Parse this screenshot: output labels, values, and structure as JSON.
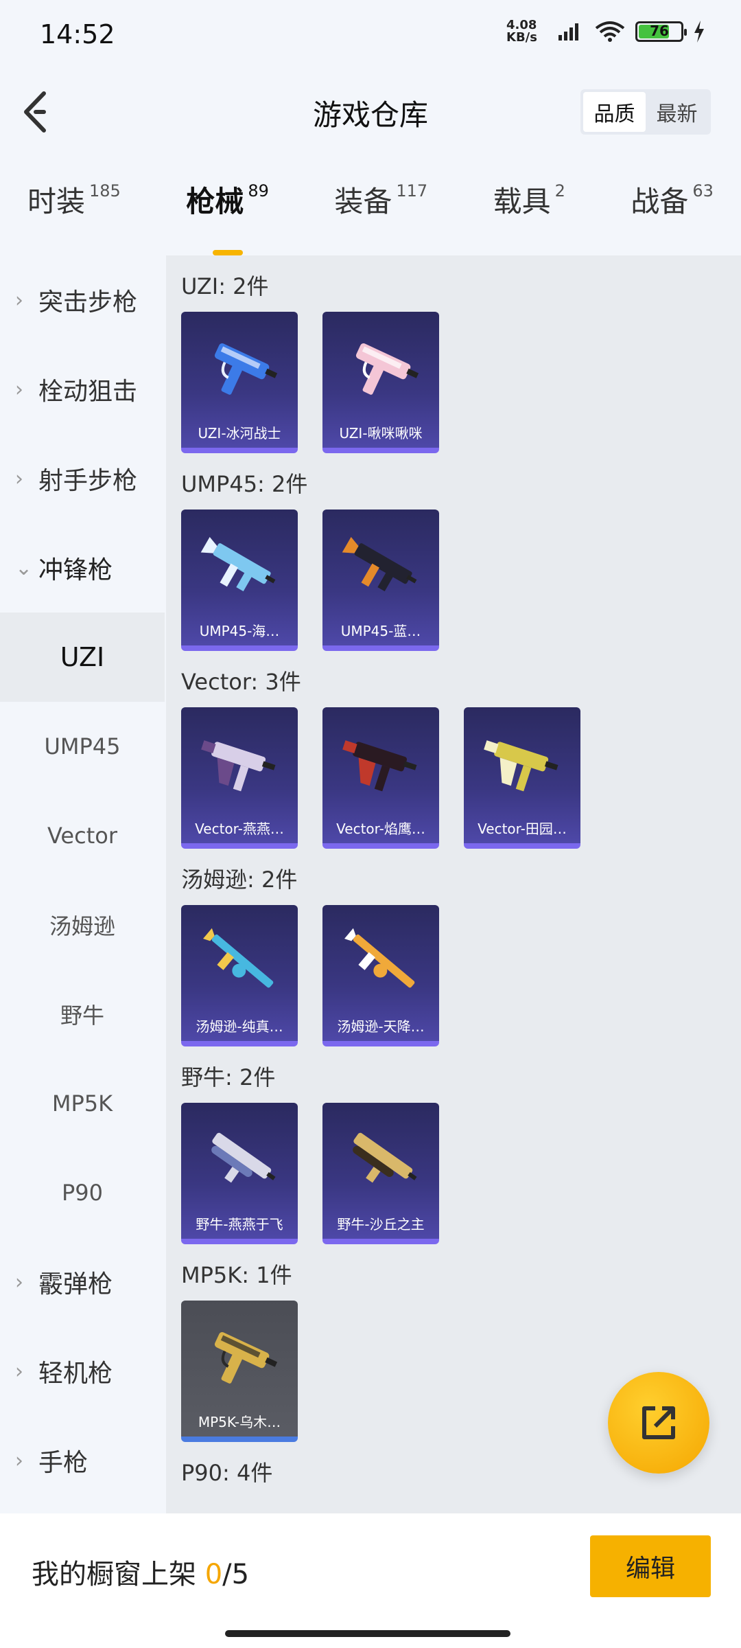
{
  "status": {
    "time": "14:52",
    "net_speed_top": "4.08",
    "net_speed_bottom": "KB/s",
    "battery": "76",
    "battery_level": 0.76
  },
  "header": {
    "title": "游戏仓库",
    "sort": [
      "品质",
      "最新"
    ],
    "active_sort": 0
  },
  "tabs": [
    {
      "label": "时装",
      "count": "185"
    },
    {
      "label": "枪械",
      "count": "89"
    },
    {
      "label": "装备",
      "count": "117"
    },
    {
      "label": "载具",
      "count": "2"
    },
    {
      "label": "战备",
      "count": "63"
    }
  ],
  "active_tab": 1,
  "sidebar": {
    "items": [
      {
        "label": "突击步枪",
        "type": "category"
      },
      {
        "label": "栓动狙击",
        "type": "category"
      },
      {
        "label": "射手步枪",
        "type": "category"
      },
      {
        "label": "冲锋枪",
        "type": "category",
        "open": true
      },
      {
        "label": "UZI",
        "type": "sub",
        "active": true
      },
      {
        "label": "UMP45",
        "type": "sub"
      },
      {
        "label": "Vector",
        "type": "sub"
      },
      {
        "label": "汤姆逊",
        "type": "sub"
      },
      {
        "label": "野牛",
        "type": "sub"
      },
      {
        "label": "MP5K",
        "type": "sub"
      },
      {
        "label": "P90",
        "type": "sub"
      },
      {
        "label": "霰弹枪",
        "type": "category"
      },
      {
        "label": "轻机枪",
        "type": "category"
      },
      {
        "label": "手枪",
        "type": "category"
      }
    ]
  },
  "groups": [
    {
      "title": "UZI: 2件",
      "items": [
        {
          "name": "UZI-冰河战士",
          "gun": "uzi",
          "colors": [
            "#3C7BE8",
            "#E8F0FF"
          ]
        },
        {
          "name": "UZI-啾咪啾咪",
          "gun": "uzi",
          "colors": [
            "#F4C6D6",
            "#FFFFFF"
          ]
        }
      ]
    },
    {
      "title": "UMP45: 2件",
      "items": [
        {
          "name": "UMP45-海…",
          "gun": "smg",
          "colors": [
            "#7EC8F0",
            "#E8F3FF"
          ]
        },
        {
          "name": "UMP45-蓝…",
          "gun": "smg",
          "colors": [
            "#222230",
            "#E58A2A"
          ]
        }
      ]
    },
    {
      "title": "Vector: 3件",
      "items": [
        {
          "name": "Vector-燕燕…",
          "gun": "vector",
          "colors": [
            "#D8CFE8",
            "#6B4A8A"
          ]
        },
        {
          "name": "Vector-焰鹰…",
          "gun": "vector",
          "colors": [
            "#2A1A22",
            "#C0392B"
          ]
        },
        {
          "name": "Vector-田园…",
          "gun": "vector",
          "colors": [
            "#D8C84A",
            "#F4F0C8"
          ]
        }
      ]
    },
    {
      "title": "汤姆逊: 2件",
      "items": [
        {
          "name": "汤姆逊-纯真…",
          "gun": "tommy",
          "colors": [
            "#47B8E0",
            "#F2C94C"
          ]
        },
        {
          "name": "汤姆逊-天降…",
          "gun": "tommy",
          "colors": [
            "#F0A93A",
            "#FFFFFF"
          ]
        }
      ]
    },
    {
      "title": "野牛: 2件",
      "items": [
        {
          "name": "野牛-燕燕于飞",
          "gun": "bizon",
          "colors": [
            "#D9D9E8",
            "#6C7AB8"
          ]
        },
        {
          "name": "野牛-沙丘之主",
          "gun": "bizon",
          "colors": [
            "#D9B86A",
            "#3A2E1E"
          ]
        }
      ]
    },
    {
      "title": "MP5K: 1件",
      "items": [
        {
          "name": "MP5K-乌木…",
          "gun": "uzi",
          "colors": [
            "#D8B24A",
            "#2A2A2A"
          ],
          "gray": true
        }
      ]
    },
    {
      "title": "P90: 4件",
      "items": []
    }
  ],
  "bottom": {
    "label": "我的橱窗上架 ",
    "current": "0",
    "total": "/5",
    "edit": "编辑"
  }
}
